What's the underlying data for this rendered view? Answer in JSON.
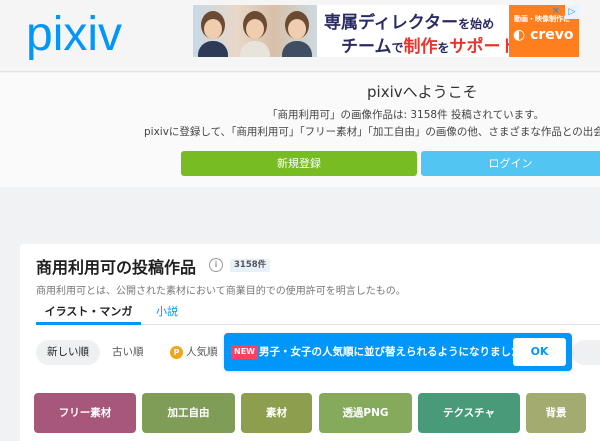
{
  "header": {
    "logo": "pixiv",
    "ad": {
      "line1": "専属ディレクター",
      "line1_suffix": "を始め",
      "line2_a": "チーム",
      "line2_b": "で",
      "line2_c": "制作",
      "line2_d": "を",
      "line2_e": "サポート",
      "brand_top": "動画・映像制作に",
      "brand_name": "crevo",
      "close": "✕",
      "choice": "▷"
    }
  },
  "welcome": {
    "title": "pixivへようこそ",
    "line1": "「商用利用可」の画像作品は: 3158件 投稿されています。",
    "line2": "pixivに登録して、「商用利用可」「フリー素材」「加工自由」の画像の他、さまざまな作品との出会い",
    "signup_label": "新規登録",
    "login_label": "ログイン"
  },
  "section": {
    "title": "商用利用可の投稿作品",
    "info_icon": "i",
    "count": "3158件",
    "description": "商用利用可とは、公開された素材において商業目的での使用許可を明言したもの。",
    "tabs": [
      {
        "label": "イラスト・マンガ",
        "active": true
      },
      {
        "label": "小説",
        "active": false
      }
    ],
    "sort": {
      "new": "新しい順",
      "old": "古い順",
      "popular": "人気順",
      "premium_icon": "P"
    }
  },
  "toast": {
    "badge": "NEW",
    "message": "男子・女子の人気順に並び替えられるようになりました",
    "ok_label": "OK"
  },
  "tags": [
    {
      "label": "フリー素材",
      "color": "#a7577a"
    },
    {
      "label": "加工自由",
      "color": "#7f9d56"
    },
    {
      "label": "素材",
      "color": "#8d9f4f"
    },
    {
      "label": "透過PNG",
      "color": "#86aa5c"
    },
    {
      "label": "テクスチャ",
      "color": "#499a78"
    },
    {
      "label": "背景",
      "color": "#a3ab71"
    }
  ],
  "colors": {
    "brand": "#0096fa",
    "signup": "#76bc22",
    "login": "#52c5f2"
  }
}
